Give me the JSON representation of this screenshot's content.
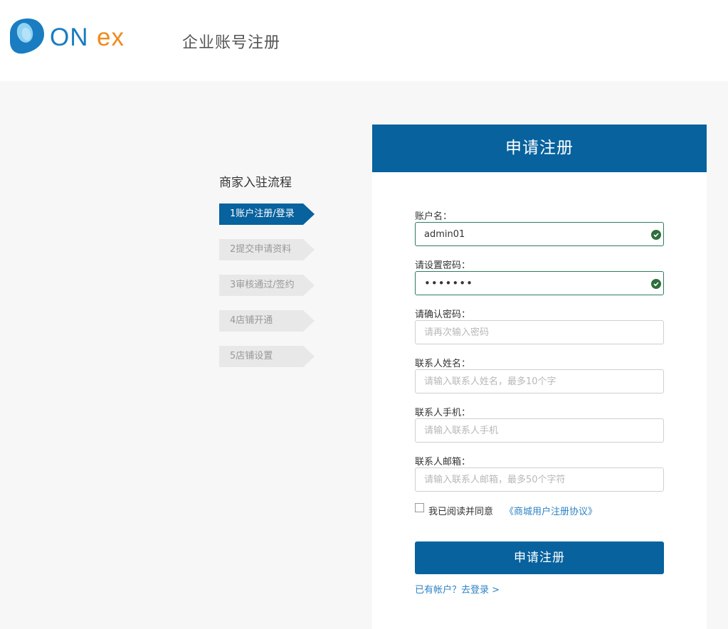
{
  "header": {
    "logo_text": "ONex",
    "page_title": "企业账号注册"
  },
  "steps": {
    "title": "商家入驻流程",
    "items": [
      {
        "label": "1账户注册/登录",
        "active": true
      },
      {
        "label": "2提交申请资料",
        "active": false
      },
      {
        "label": "3审核通过/签约",
        "active": false
      },
      {
        "label": "4店铺开通",
        "active": false
      },
      {
        "label": "5店铺设置",
        "active": false
      }
    ]
  },
  "form": {
    "title": "申请注册",
    "account": {
      "label": "账户名：",
      "value": "admin01"
    },
    "password": {
      "label": "请设置密码：",
      "value": "1234567"
    },
    "confirm": {
      "label": "请确认密码：",
      "placeholder": "请再次输入密码"
    },
    "contact_name": {
      "label": "联系人姓名：",
      "placeholder": "请输入联系人姓名，最多10个字"
    },
    "contact_phone": {
      "label": "联系人手机：",
      "placeholder": "请输入联系人手机"
    },
    "contact_email": {
      "label": "联系人邮箱：",
      "placeholder": "请输入联系人邮箱，最多50个字符"
    },
    "agree_text": "我已阅读并同意",
    "agree_link": "《商城用户注册协议》",
    "submit_label": "申请注册",
    "login_link": "已有帐户？去登录 >"
  },
  "colors": {
    "brand_blue": "#07629e",
    "logo_blue": "#1a7cc1",
    "logo_orange": "#f08a1c",
    "valid_green": "#2f7d5b",
    "link_blue": "#2d83c4"
  }
}
